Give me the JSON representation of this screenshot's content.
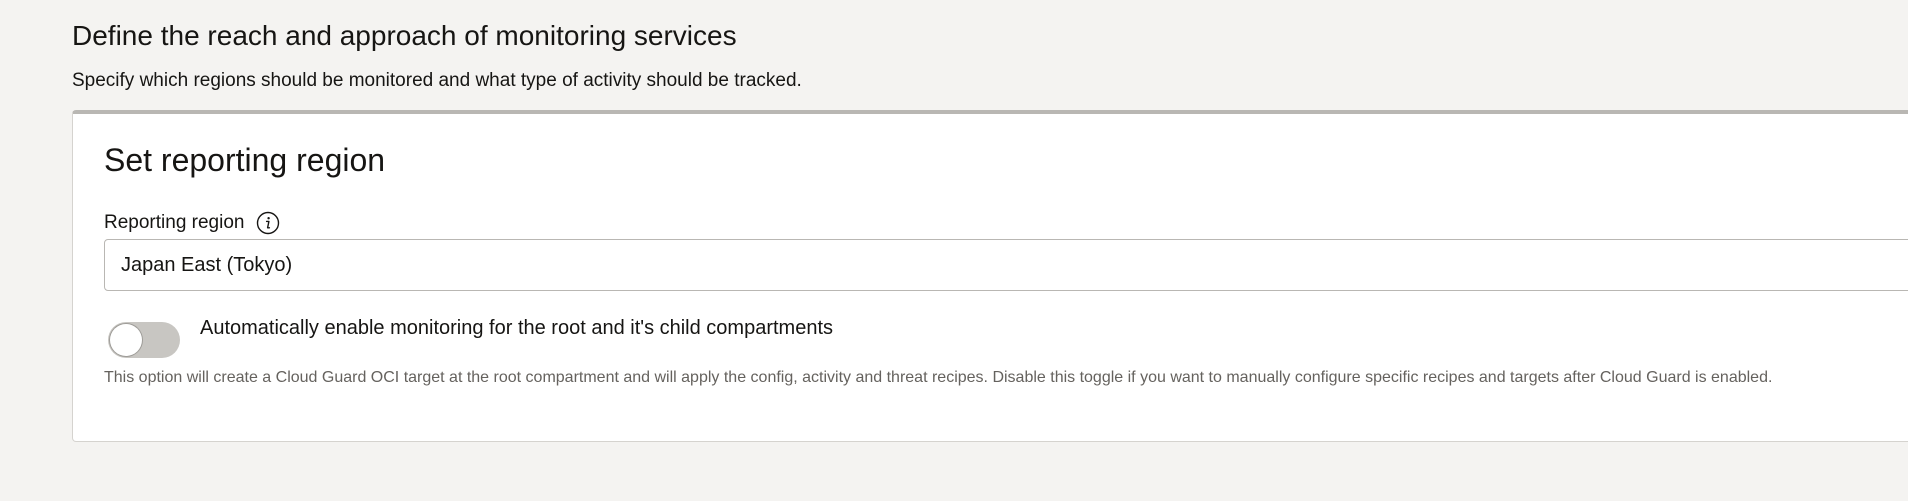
{
  "section": {
    "title": "Define the reach and approach of monitoring services",
    "subtitle": "Specify which regions should be monitored and what type of activity should be tracked."
  },
  "card": {
    "title": "Set reporting region",
    "reporting_region": {
      "label": "Reporting region",
      "info_icon": "info-icon",
      "value": "Japan East (Tokyo)"
    },
    "auto_enable": {
      "label": "Automatically enable monitoring for the root and it's child compartments",
      "enabled": false
    },
    "help_text": "This option will create a Cloud Guard OCI target at the root compartment and will apply the config, activity and threat recipes. Disable this toggle if you want to manually configure specific recipes and targets after Cloud Guard is enabled."
  },
  "colors": {
    "background": "#f4f3f1",
    "card": "#ffffff",
    "toggle_off": "#c8c6c2",
    "text": "#161513",
    "muted_text": "#65625e"
  }
}
